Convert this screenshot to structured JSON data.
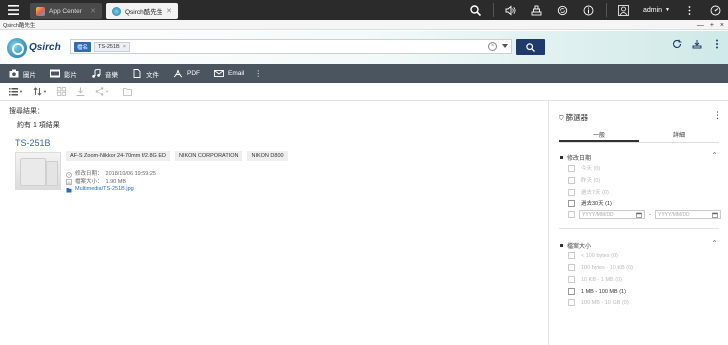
{
  "os": {
    "tabs": [
      {
        "label": "App Center",
        "active": false
      },
      {
        "label": "Qsirch酷先生",
        "active": true
      }
    ],
    "user": "admin",
    "colors": {
      "bar": "#2b2b2b",
      "accent": "#1f3a6b",
      "link": "#2a6bb5"
    }
  },
  "window": {
    "title": "Qsirch酷先生",
    "controls": [
      "—",
      "+",
      "×"
    ]
  },
  "header": {
    "logo_text": "Qsirch",
    "search": {
      "field_chip": "檔名",
      "value_chip": "TS-251B",
      "value_chip_close": "×",
      "clear": "×"
    }
  },
  "categories": [
    {
      "label": "圖片",
      "icon": "photo-icon"
    },
    {
      "label": "影片",
      "icon": "video-icon"
    },
    {
      "label": "音樂",
      "icon": "music-icon"
    },
    {
      "label": "文件",
      "icon": "document-icon"
    },
    {
      "label": "PDF",
      "icon": "pdf-icon"
    },
    {
      "label": "Email",
      "icon": "email-icon"
    }
  ],
  "category_more": "⋮",
  "results": {
    "label": "搜尋結果：",
    "count": "約有 1 項結果",
    "items": [
      {
        "title": "TS-251B",
        "tags": [
          "AF-S Zoom-Nikkor 24-70mm f/2.8G ED",
          "NIKON CORPORATION",
          "NIKON D800"
        ],
        "modified_label": "修改日期：",
        "modified": "2018/10/06 19:59:25",
        "size_label": "檔案大小：",
        "size": "1.90 MB",
        "path": "Multimedia/TS-251B.jpg"
      }
    ]
  },
  "filter": {
    "title": "篩選器",
    "more": "⋮",
    "tabs": [
      "一般",
      "詳細"
    ],
    "date_section": {
      "title": "修改日期",
      "options": [
        {
          "label": "今天 (0)",
          "enabled": false
        },
        {
          "label": "昨天 (0)",
          "enabled": false
        },
        {
          "label": "過去7天 (0)",
          "enabled": false
        },
        {
          "label": "過去30天 (1)",
          "enabled": true
        }
      ],
      "from_placeholder": "YYYY/MM/DD",
      "to_placeholder": "YYYY/MM/DD",
      "dash": "-"
    },
    "size_section": {
      "title": "檔案大小",
      "options": [
        {
          "label": "< 100 bytes (0)",
          "enabled": false
        },
        {
          "label": "100 bytes - 10 KB (0)",
          "enabled": false
        },
        {
          "label": "10 KB - 1 MB (0)",
          "enabled": false
        },
        {
          "label": "1 MB - 100 MB (1)",
          "enabled": true
        },
        {
          "label": "100 MB - 10 GB (0)",
          "enabled": false
        }
      ]
    }
  }
}
